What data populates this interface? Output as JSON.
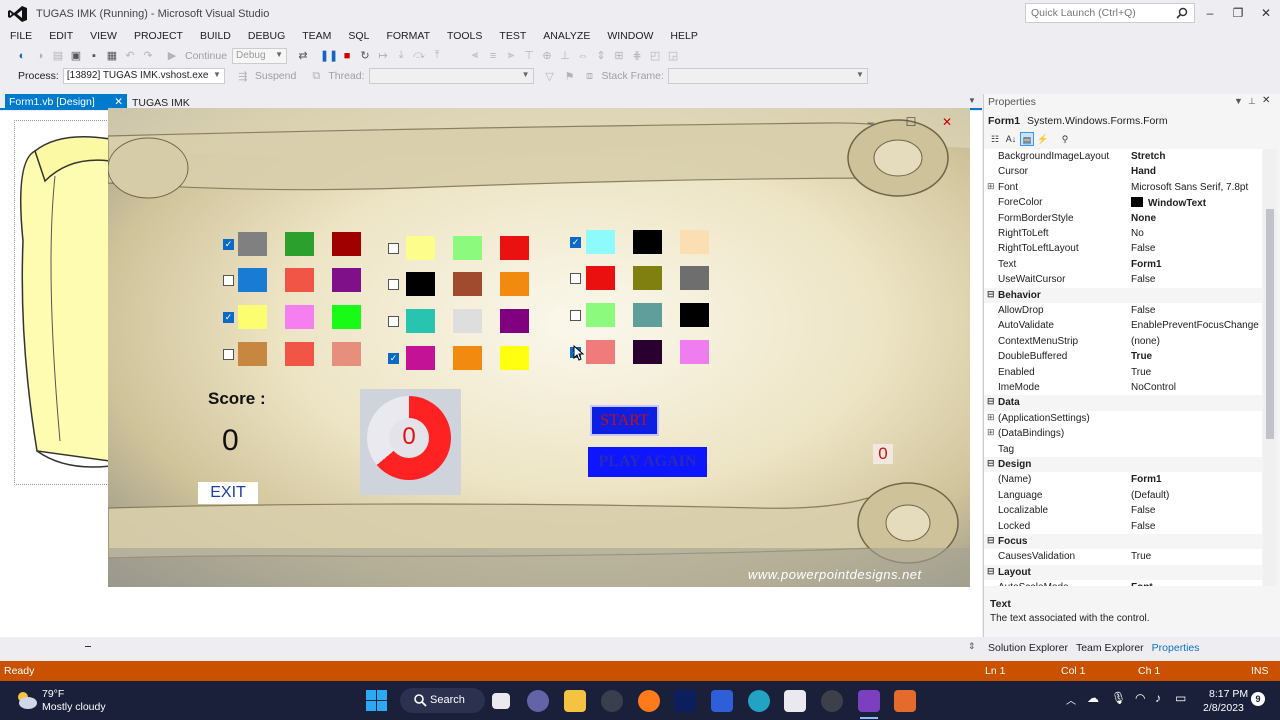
{
  "window": {
    "title": "TUGAS IMK (Running) - Microsoft Visual Studio",
    "quick_launch_placeholder": "Quick Launch (Ctrl+Q)",
    "controls": [
      "–",
      "❐",
      "✕"
    ]
  },
  "menu": [
    "FILE",
    "EDIT",
    "VIEW",
    "PROJECT",
    "BUILD",
    "DEBUG",
    "TEAM",
    "SQL",
    "FORMAT",
    "TOOLS",
    "TEST",
    "ANALYZE",
    "WINDOW",
    "HELP"
  ],
  "toolbar": {
    "continue_label": "Continue",
    "config_value": "Debug"
  },
  "debug_toolbar": {
    "process_label": "Process:",
    "process_value": "[13892] TUGAS IMK.vshost.exe",
    "suspend_label": "Suspend",
    "thread_label": "Thread:",
    "stack_frame_label": "Stack Frame:"
  },
  "doc_tabs": {
    "active": "Form1.vb [Design]",
    "other": "TUGAS IMK"
  },
  "game": {
    "window_controls": [
      "–",
      "☐",
      "✕"
    ],
    "score_label": "Score :",
    "score_value": "0",
    "exit_label": "EXIT",
    "timer_value": "0",
    "start_label": "START",
    "play_again_label": "PLAY AGAIN",
    "side_score": "0",
    "watermark": "www.powerpointdesigns.net",
    "groups": [
      {
        "rows": [
          {
            "checked": true,
            "colors": [
              "#808080",
              "#2ca02c",
              "#a00000"
            ]
          },
          {
            "checked": false,
            "colors": [
              "#1a7bd4",
              "#f05545",
              "#80108a"
            ]
          },
          {
            "checked": true,
            "colors": [
              "#fdfd70",
              "#f57ef0",
              "#17fb17"
            ]
          },
          {
            "checked": false,
            "colors": [
              "#c88740",
              "#f05545",
              "#e68f7c"
            ]
          }
        ]
      },
      {
        "rows": [
          {
            "checked": false,
            "colors": [
              "#fdfd8c",
              "#8bfa7d",
              "#ec1111"
            ]
          },
          {
            "checked": false,
            "colors": [
              "#000000",
              "#a04b2e",
              "#f28a10"
            ]
          },
          {
            "checked": false,
            "colors": [
              "#28c4b0",
              "#dedede",
              "#800080"
            ]
          },
          {
            "checked": true,
            "colors": [
              "#c41296",
              "#f28a10",
              "#ffff10"
            ]
          }
        ]
      },
      {
        "rows": [
          {
            "checked": true,
            "colors": [
              "#8dfafc",
              "#000000",
              "#fbdeb2"
            ]
          },
          {
            "checked": false,
            "colors": [
              "#ea1010",
              "#808010",
              "#6e6e6e"
            ]
          },
          {
            "checked": false,
            "colors": [
              "#8bfa7d",
              "#5f9e9a",
              "#000000"
            ]
          },
          {
            "checked": true,
            "colors": [
              "#f17b7b",
              "#2a0030",
              "#ef7ded"
            ]
          }
        ]
      }
    ]
  },
  "properties": {
    "title": "Properties",
    "object": "Form1",
    "object_type": "System.Windows.Forms.Form",
    "rows": [
      {
        "name": "BackgroundImageLayout",
        "value": "Stretch",
        "bold": true
      },
      {
        "name": "Cursor",
        "value": "Hand",
        "bold": true
      },
      {
        "name": "Font",
        "value": "Microsoft Sans Serif, 7.8pt",
        "expand": true
      },
      {
        "name": "ForeColor",
        "value": "WindowText",
        "bold": true,
        "swatch": "#000000"
      },
      {
        "name": "FormBorderStyle",
        "value": "None",
        "bold": true
      },
      {
        "name": "RightToLeft",
        "value": "No"
      },
      {
        "name": "RightToLeftLayout",
        "value": "False"
      },
      {
        "name": "Text",
        "value": "Form1",
        "bold": true
      },
      {
        "name": "UseWaitCursor",
        "value": "False"
      },
      {
        "category": "Behavior"
      },
      {
        "name": "AllowDrop",
        "value": "False"
      },
      {
        "name": "AutoValidate",
        "value": "EnablePreventFocusChange"
      },
      {
        "name": "ContextMenuStrip",
        "value": "(none)"
      },
      {
        "name": "DoubleBuffered",
        "value": "True",
        "bold": true
      },
      {
        "name": "Enabled",
        "value": "True"
      },
      {
        "name": "ImeMode",
        "value": "NoControl"
      },
      {
        "category": "Data"
      },
      {
        "name": "(ApplicationSettings)",
        "value": "",
        "expand": true
      },
      {
        "name": "(DataBindings)",
        "value": "",
        "expand": true
      },
      {
        "name": "Tag",
        "value": ""
      },
      {
        "category": "Design"
      },
      {
        "name": "(Name)",
        "value": "Form1",
        "bold": true
      },
      {
        "name": "Language",
        "value": "(Default)"
      },
      {
        "name": "Localizable",
        "value": "False"
      },
      {
        "name": "Locked",
        "value": "False"
      },
      {
        "category": "Focus"
      },
      {
        "name": "CausesValidation",
        "value": "True"
      },
      {
        "category": "Layout"
      },
      {
        "name": "AutoScaleMode",
        "value": "Font",
        "bold": true
      }
    ],
    "desc_title": "Text",
    "desc_text": "The text associated with the control."
  },
  "bottom_tabs": [
    "Solution Explorer",
    "Team Explorer",
    "Properties"
  ],
  "status": {
    "left": "Ready",
    "ln": "Ln 1",
    "col": "Col 1",
    "ch": "Ch 1",
    "mode": "INS"
  },
  "taskbar": {
    "weather_temp": "79°F",
    "weather_desc": "Mostly cloudy",
    "search_label": "Search",
    "time": "8:17 PM",
    "date": "2/8/2023",
    "notification_count": "9"
  }
}
